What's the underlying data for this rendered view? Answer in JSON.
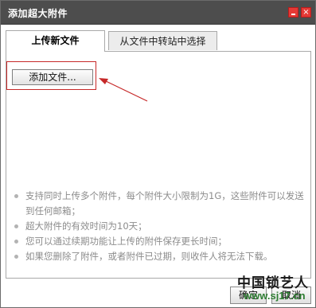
{
  "window": {
    "title": "添加超大附件",
    "min_label": "_",
    "close_label": "×"
  },
  "tabs": [
    {
      "label": "上传新文件",
      "active": true
    },
    {
      "label": "从文件中转站中选择",
      "active": false
    }
  ],
  "upload": {
    "add_file_label": "添加文件..."
  },
  "notes": [
    "支持同时上传多个附件，每个附件大小限制为1G，这些附件可以发送到任何邮箱；",
    "超大附件的有效时间为10天；",
    "您可以通过续期功能让上传的附件保存更长时间；",
    "如果您删除了附件，或者附件已过期，则收件人将无法下载。"
  ],
  "footer": {
    "ok_label": "确定",
    "cancel_label": "取消"
  },
  "watermark": {
    "line1": "中国锁艺人",
    "line2": "www.sj17.cn"
  },
  "colors": {
    "titlebar": "#4d4d4d",
    "highlight": "#c62828",
    "accent_red": "#e53935"
  }
}
